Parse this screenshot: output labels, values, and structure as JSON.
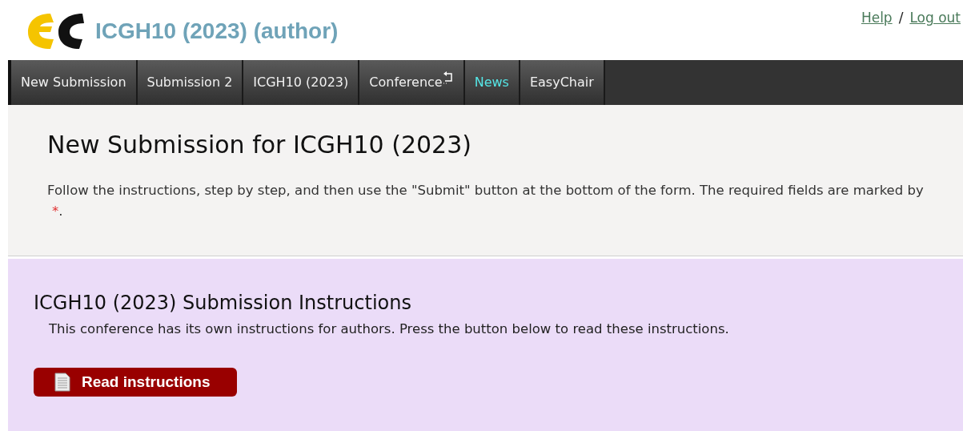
{
  "header": {
    "title": "ICGH10 (2023) (author)",
    "links": [
      "Help",
      "Log out"
    ],
    "separator": "/"
  },
  "menu": [
    {
      "label": "New Submission",
      "highlighted": false,
      "has_submenu": false
    },
    {
      "label": "Submission 2",
      "highlighted": false,
      "has_submenu": false
    },
    {
      "label": "ICGH10 (2023)",
      "highlighted": false,
      "has_submenu": false
    },
    {
      "label": "Conference",
      "highlighted": false,
      "has_submenu": true
    },
    {
      "label": "News",
      "highlighted": true,
      "has_submenu": false
    },
    {
      "label": "EasyChair",
      "highlighted": false,
      "has_submenu": false
    }
  ],
  "intro": {
    "heading": "New Submission for ICGH10 (2023)",
    "text": "Follow the instructions, step by step, and then use the \"Submit\" button at the bottom of the form. The required fields are marked by ",
    "required_mark": "*",
    "text_end": "."
  },
  "instructions": {
    "heading": "ICGH10 (2023) Submission Instructions",
    "text": "This conference has its own instructions for authors. Press the button below to read these instructions.",
    "button": "Read instructions"
  }
}
